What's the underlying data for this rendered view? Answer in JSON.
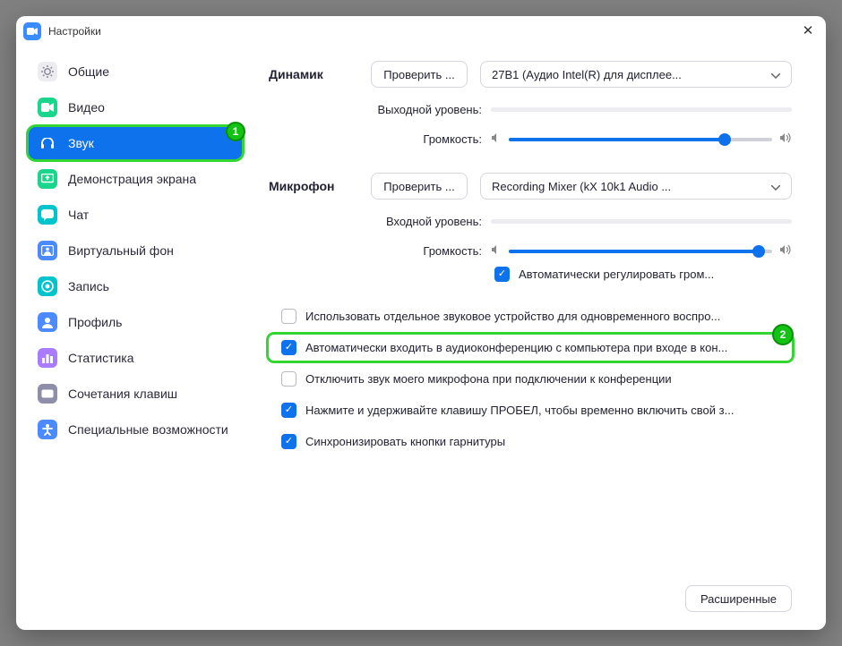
{
  "window": {
    "title": "Настройки"
  },
  "sidebar": {
    "items": [
      {
        "label": "Общие",
        "icon": "gear",
        "bg": "#ececf1",
        "fg": "#8a8a98"
      },
      {
        "label": "Видео",
        "icon": "camera",
        "bg": "#1ad68c",
        "fg": "#fff"
      },
      {
        "label": "Звук",
        "icon": "headphones",
        "bg": "#0e72ed",
        "fg": "#fff",
        "selected": true,
        "highlight": 1
      },
      {
        "label": "Демонстрация экрана",
        "icon": "share",
        "bg": "#1ad68c",
        "fg": "#fff"
      },
      {
        "label": "Чат",
        "icon": "chat",
        "bg": "#00c4cc",
        "fg": "#fff"
      },
      {
        "label": "Виртуальный фон",
        "icon": "bg",
        "bg": "#4b8bff",
        "fg": "#fff"
      },
      {
        "label": "Запись",
        "icon": "record",
        "bg": "#00c4cc",
        "fg": "#fff"
      },
      {
        "label": "Профиль",
        "icon": "profile",
        "bg": "#4b8bff",
        "fg": "#fff"
      },
      {
        "label": "Статистика",
        "icon": "stats",
        "bg": "#a97cff",
        "fg": "#fff"
      },
      {
        "label": "Сочетания клавиш",
        "icon": "keyboard",
        "bg": "#8e8ea8",
        "fg": "#fff"
      },
      {
        "label": "Специальные возможности",
        "icon": "access",
        "bg": "#4b8bff",
        "fg": "#fff"
      }
    ]
  },
  "speaker": {
    "label": "Динамик",
    "test": "Проверить ...",
    "device": "27B1 (Аудио Intel(R) для дисплее...",
    "output_level_label": "Выходной уровень:",
    "volume_label": "Громкость:",
    "volume": 82
  },
  "mic": {
    "label": "Микрофон",
    "test": "Проверить ...",
    "device": "Recording Mixer (kX 10k1 Audio ...",
    "input_level_label": "Входной уровень:",
    "volume_label": "Громкость:",
    "volume": 95,
    "auto_label": "Автоматически регулировать гром...",
    "auto_checked": true
  },
  "options": [
    {
      "checked": false,
      "text": "Использовать отдельное звуковое устройство для одновременного воспро..."
    },
    {
      "checked": true,
      "text": "Автоматически входить в аудиоконференцию с компьютера при входе в кон...",
      "highlight": 2
    },
    {
      "checked": false,
      "text": "Отключить звук моего микрофона при подключении к конференции"
    },
    {
      "checked": true,
      "text": "Нажмите и удерживайте клавишу ПРОБЕЛ, чтобы временно включить свой з..."
    },
    {
      "checked": true,
      "text": "Синхронизировать кнопки гарнитуры"
    }
  ],
  "footer": {
    "advanced": "Расширенные"
  }
}
